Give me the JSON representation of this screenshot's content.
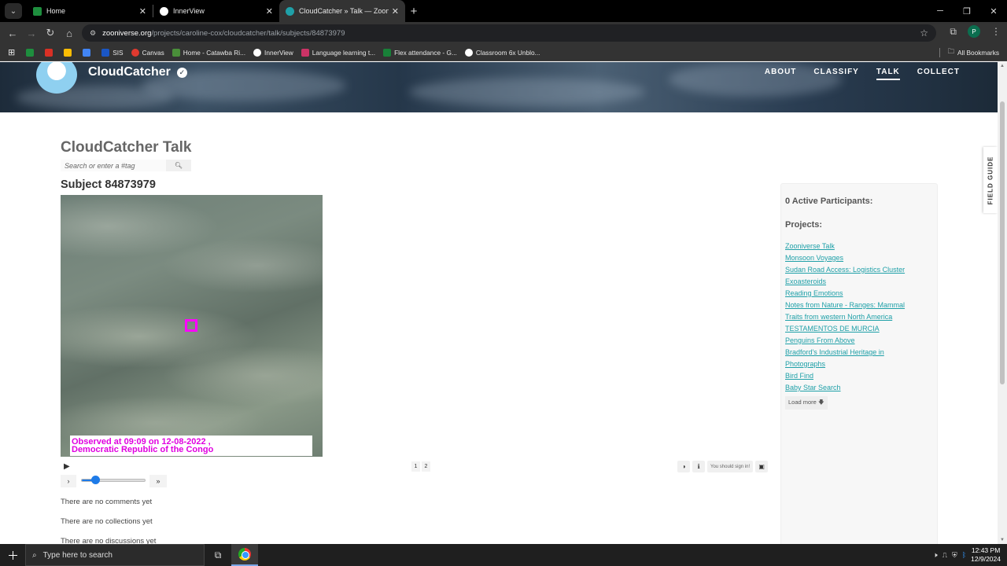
{
  "tabs": [
    {
      "title": "Home",
      "color": "#1e8e3e",
      "active": false
    },
    {
      "title": "InnerView",
      "color": "#ffffff",
      "active": false
    },
    {
      "title": "CloudCatcher » Talk — Zooniver",
      "color": "#1fa0a8",
      "active": true
    }
  ],
  "address": {
    "domain": "zooniverse.org",
    "path": "/projects/caroline-cox/cloudcatcher/talk/subjects/84873979"
  },
  "profile_initial": "P",
  "bookmarks": [
    {
      "label": "",
      "color": "#1e8e3e"
    },
    {
      "label": "",
      "color": "#d93025"
    },
    {
      "label": "",
      "color": "#fbbc04"
    },
    {
      "label": "",
      "color": "#4285f4"
    },
    {
      "label": "SIS",
      "color": "#1a56c4"
    },
    {
      "label": "Canvas",
      "color": "#e03a2f"
    },
    {
      "label": "Home - Catawba Ri...",
      "color": "#4a8f3a"
    },
    {
      "label": "InnerView",
      "color": "#ffffff"
    },
    {
      "label": "Language learning t...",
      "color": "#c36"
    },
    {
      "label": "Flex attendance - G...",
      "color": "#188038"
    },
    {
      "label": "Classroom 6x Unblo...",
      "color": "#ffffff"
    }
  ],
  "all_bookmarks": "All Bookmarks",
  "project": {
    "name": "CloudCatcher"
  },
  "nav": [
    "ABOUT",
    "CLASSIFY",
    "TALK",
    "COLLECT"
  ],
  "talk_title": "CloudCatcher Talk",
  "search_placeholder": "Search or enter a #tag",
  "subject_title": "Subject 84873979",
  "caption": {
    "line1": "Observed at 09:09 on 12-08-2022 ,",
    "line2": "Democratic Republic of the Congo"
  },
  "pages": [
    "1",
    "2"
  ],
  "sign_in_text": "You should sign in!",
  "frame_progress": 0.22,
  "empty_states": [
    "There are no comments yet",
    "There are no collections yet",
    "There are no discussions yet"
  ],
  "sidebar": {
    "participants": "0 Active Participants:",
    "projects_heading": "Projects:",
    "projects": [
      "Zooniverse Talk",
      "Monsoon Voyages",
      "Sudan Road Access: Logistics Cluster",
      "Exoasteroids",
      "Reading Emotions",
      "Notes from Nature - Ranges: Mammal",
      "Traits from western North America",
      "TESTAMENTOS DE MURCIA",
      "Penguins From Above",
      "Bradford's Industrial Heritage in",
      "Photographs",
      "Bird Find",
      "Baby Star Search"
    ],
    "load_more": "Load more"
  },
  "field_guide": "FIELD GUIDE",
  "taskbar": {
    "search_placeholder": "Type here to search",
    "time": "12:43 PM",
    "date": "12/9/2024"
  }
}
